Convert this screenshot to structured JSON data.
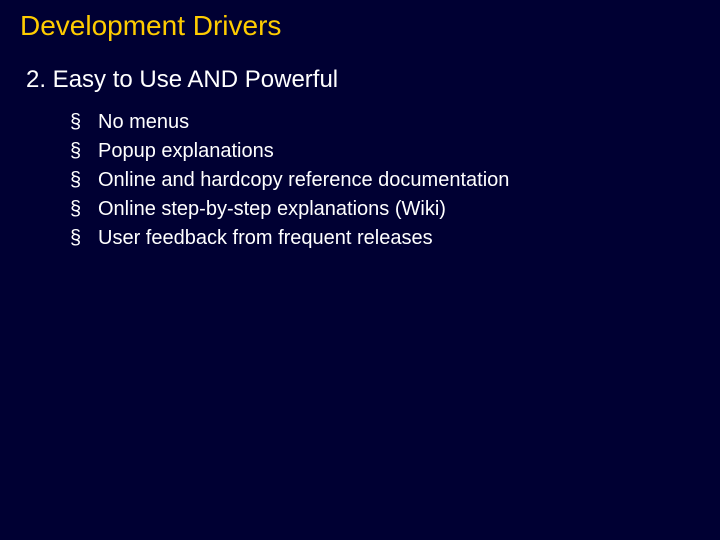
{
  "title": "Development Drivers",
  "subtitle": "2. Easy to Use AND Powerful",
  "bullets": [
    "No menus",
    "Popup explanations",
    "Online and hardcopy reference documentation",
    "Online step-by-step explanations (Wiki)",
    "User feedback from frequent releases"
  ]
}
